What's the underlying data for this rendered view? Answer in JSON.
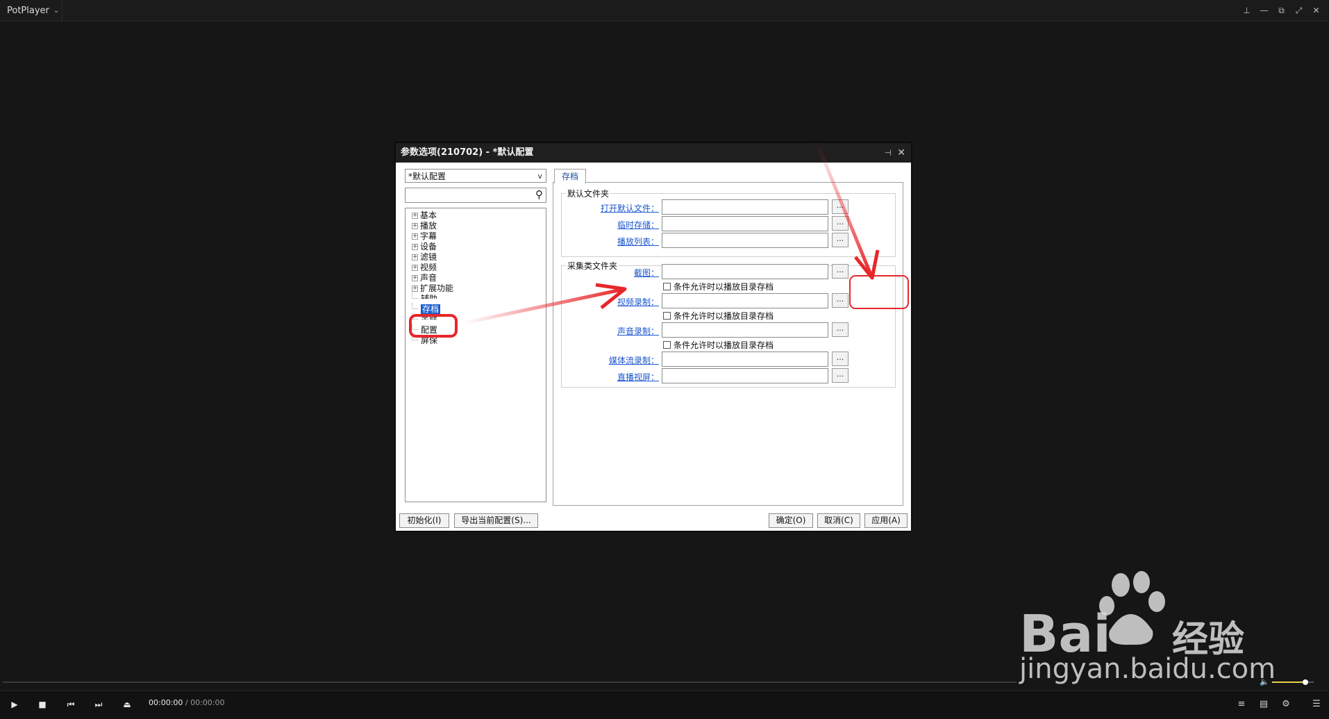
{
  "app": {
    "title": "PotPlayer",
    "window_controls": [
      "pin-icon",
      "minimize-icon",
      "restore-icon",
      "fullscreen-icon",
      "close-icon"
    ]
  },
  "dialog": {
    "title": "参数选项(210702) - *默认配置",
    "preset_value": "*默认配置",
    "search_placeholder": "",
    "tree_items": [
      {
        "label": "基本",
        "expandable": true
      },
      {
        "label": "播放",
        "expandable": true
      },
      {
        "label": "字幕",
        "expandable": true
      },
      {
        "label": "设备",
        "expandable": true
      },
      {
        "label": "滤镜",
        "expandable": true
      },
      {
        "label": "视频",
        "expandable": true
      },
      {
        "label": "声音",
        "expandable": true
      },
      {
        "label": "扩展功能",
        "expandable": true
      },
      {
        "label": "辅助",
        "expandable": false
      },
      {
        "label": "存档",
        "expandable": false,
        "selected": true
      },
      {
        "label": "关联",
        "expandable": false
      },
      {
        "label": "配置",
        "expandable": false
      },
      {
        "label": "屏保",
        "expandable": false
      }
    ],
    "tab_label": "存档",
    "group1": {
      "title": "默认文件夹",
      "rows": [
        {
          "label": "打开默认文件：",
          "value": ""
        },
        {
          "label": "临时存储：",
          "value": ""
        },
        {
          "label": "播放列表：",
          "value": ""
        }
      ]
    },
    "group2": {
      "title": "采集类文件夹",
      "rows": [
        {
          "label": "截图：",
          "value": ""
        },
        {
          "label": "视频录制：",
          "value": ""
        },
        {
          "label": "声音录制：",
          "value": ""
        },
        {
          "label": "媒体流录制：",
          "value": ""
        },
        {
          "label": "直播视屏：",
          "value": ""
        }
      ],
      "checkbox_label": "条件允许时以播放目录存档"
    },
    "browse_label": "...",
    "buttons": {
      "init": "初始化(I)",
      "export": "导出当前配置(S)...",
      "ok": "确定(O)",
      "cancel": "取消(C)",
      "apply": "应用(A)"
    }
  },
  "player": {
    "time_current": "00:00:00",
    "time_separator": " / ",
    "time_total": "00:00:00",
    "volume_level": 0.8,
    "volume_color": "#e9d24a"
  },
  "annotation": {
    "color": "#e8262a"
  },
  "watermark": {
    "url": "jingyan.baidu.com"
  }
}
